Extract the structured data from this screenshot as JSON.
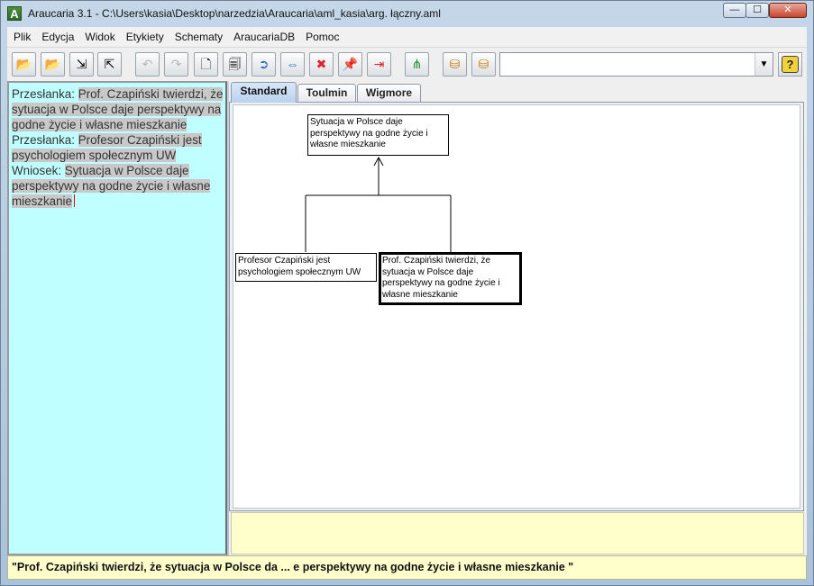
{
  "window": {
    "title": "Araucaria 3.1  - C:\\Users\\kasia\\Desktop\\narzedzia\\Araucaria\\aml_kasia\\arg. łączny.aml",
    "logo_letter": "A",
    "minimize_glyph": "—",
    "maximize_glyph": "☐",
    "close_glyph": "✕"
  },
  "menu": [
    "Plik",
    "Edycja",
    "Widok",
    "Etykiety",
    "Schematy",
    "AraucariaDB",
    "Pomoc"
  ],
  "toolbar": {
    "buttons": [
      {
        "icon": "open-folder-icon",
        "glyph": "📂"
      },
      {
        "icon": "open-folder-up-icon",
        "glyph": "📂"
      },
      {
        "icon": "import-icon",
        "glyph": "⇲"
      },
      {
        "icon": "export-icon",
        "glyph": "⇱"
      },
      {
        "icon": "undo-icon",
        "glyph": "↶"
      },
      {
        "icon": "redo-icon",
        "glyph": "↷"
      },
      {
        "icon": "new-document-icon",
        "glyph": "🗋"
      },
      {
        "icon": "document-list-icon",
        "glyph": "🗐"
      },
      {
        "icon": "refutation-arrow-icon",
        "glyph": "➲"
      },
      {
        "icon": "bidirectional-arrow-icon",
        "glyph": "⇔"
      },
      {
        "icon": "delete-icon",
        "glyph": "✖"
      },
      {
        "icon": "push-pin-icon",
        "glyph": "📌"
      },
      {
        "icon": "unpin-icon",
        "glyph": "⇥"
      },
      {
        "icon": "tree-icon",
        "glyph": "⋔"
      },
      {
        "icon": "database-save-icon",
        "glyph": "⛁"
      },
      {
        "icon": "database-lock-icon",
        "glyph": "⛁"
      }
    ],
    "help_glyph": "?",
    "dropdown_arrow": "▼"
  },
  "text_panel": {
    "segments": [
      {
        "text": " Przesłanka: ",
        "hl": false
      },
      {
        "text": "Prof. Czapiński twierdzi, że sytuacja w Polsce daje perspektywy na godne życie i własne mieszkanie",
        "hl": true
      },
      {
        "text": " Przesłanka: ",
        "hl": false
      },
      {
        "text": "Profesor Czapiński jest psychologiem społecznym UW",
        "hl": true
      },
      {
        "text": " Wniosek: ",
        "hl": false
      },
      {
        "text": "Sytuacja w Polsce daje perspektywy na godne życie i własne mieszkanie",
        "hl": true
      }
    ]
  },
  "tabs": [
    "Standard",
    "Toulmin",
    "Wigmore"
  ],
  "diagram": {
    "conclusion": "Sytuacja w Polsce daje perspektywy na godne życie i własne mieszkanie",
    "premise_left": "Profesor Czapiński jest psychologiem społecznym UW",
    "premise_right": "Prof. Czapiński twierdzi, że sytuacja w Polsce daje perspektywy na godne życie i własne mieszkanie"
  },
  "status": "\"Prof. Czapiński twierdzi, że sytuacja w Polsce da ... e perspektywy na godne życie i własne mieszkanie \""
}
